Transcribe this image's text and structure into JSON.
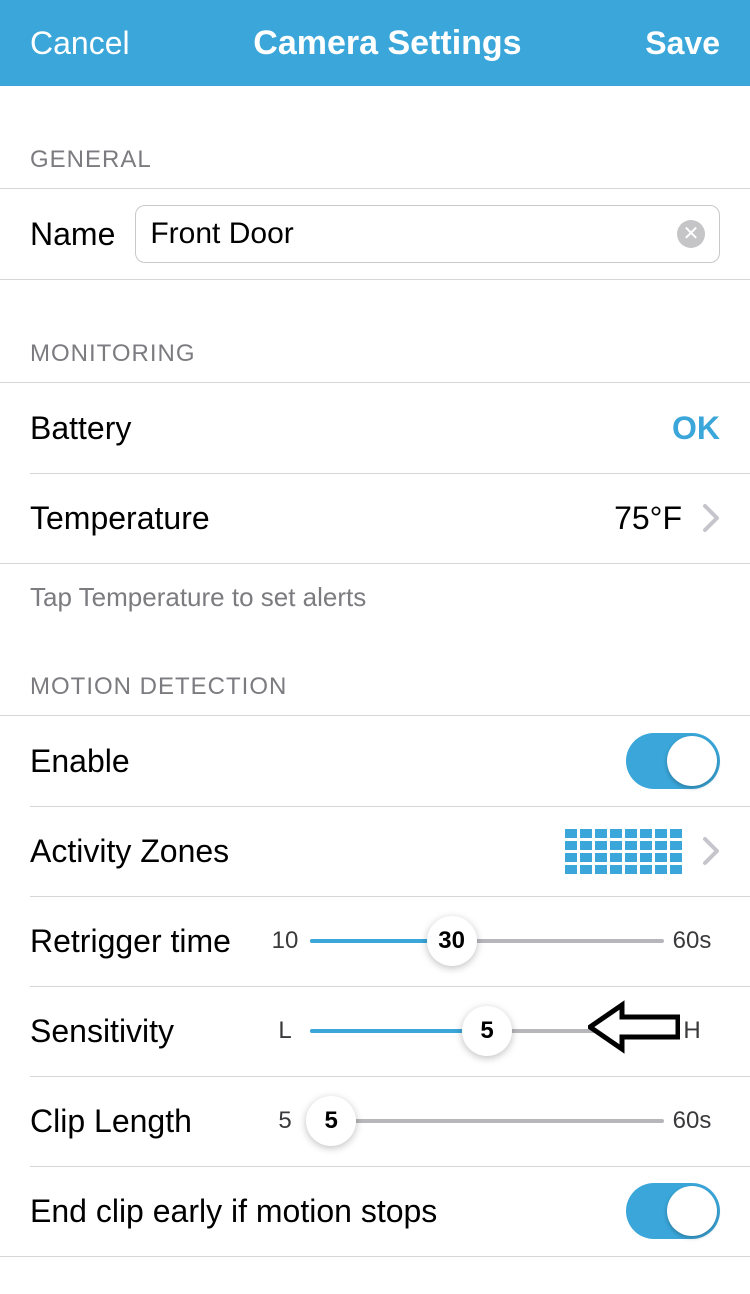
{
  "header": {
    "cancel": "Cancel",
    "title": "Camera Settings",
    "save": "Save"
  },
  "general": {
    "header": "GENERAL",
    "name_label": "Name",
    "name_value": "Front Door"
  },
  "monitoring": {
    "header": "MONITORING",
    "battery_label": "Battery",
    "battery_status": "OK",
    "temperature_label": "Temperature",
    "temperature_value": "75°F",
    "footer": "Tap Temperature to set alerts"
  },
  "motion": {
    "header": "MOTION DETECTION",
    "enable_label": "Enable",
    "zones_label": "Activity Zones",
    "retrigger": {
      "label": "Retrigger time",
      "min": "10",
      "value": "30",
      "max": "60s",
      "pct": 40
    },
    "sensitivity": {
      "label": "Sensitivity",
      "min": "L",
      "value": "5",
      "max": "H",
      "pct": 50
    },
    "clip": {
      "label": "Clip Length",
      "min": "5",
      "value": "5",
      "max": "60s",
      "pct": 6
    },
    "end_early_label": "End clip early if motion stops"
  }
}
